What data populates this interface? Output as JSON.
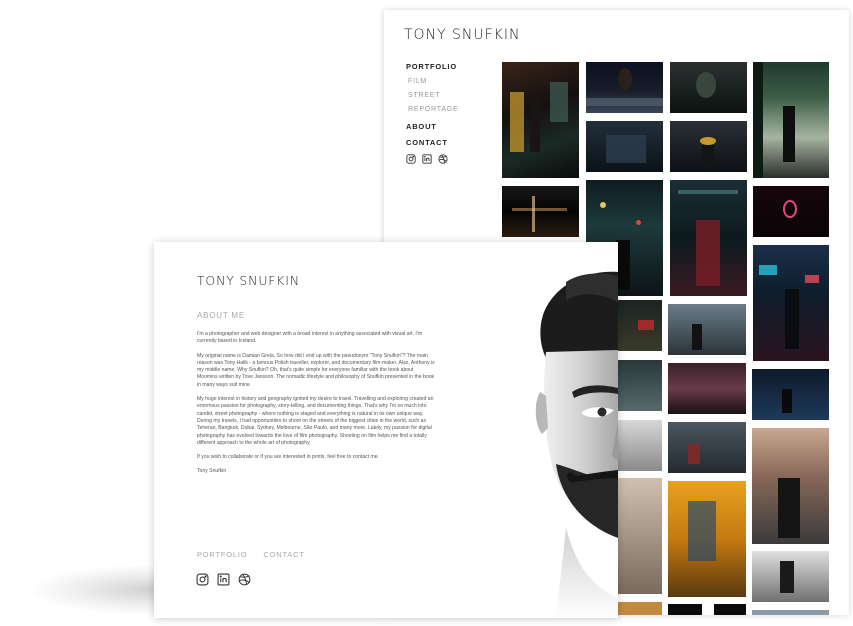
{
  "portfolio_window": {
    "brand": "TONY SNUFKIN",
    "nav": {
      "portfolio": "PORTFOLIO",
      "sub_items": [
        "FILM",
        "STREET",
        "REPORTAGE"
      ],
      "about": "ABOUT",
      "contact": "CONTACT"
    },
    "social_icons": [
      "instagram-icon",
      "linkedin-icon",
      "dribbble-icon"
    ]
  },
  "about_window": {
    "brand": "TONY SNUFKIN",
    "section_title": "ABOUT ME",
    "paragraphs": [
      "I'm a photographer and web designer with a broad interest in anything associated with visual art. I'm currently based in Iceland.",
      "My original name is Damian Grela. So how did I end up with the pseudonym \"Tony Snufkin\"? The main reason was Tony Halik - a famous Polish traveller, explorer, and documentary film-maker. Also, Anthony is my middle name. Why Snufkin? Oh, that's quite simple for everyone familiar with the book about Moomins written by Tove Jansson. The nomadic lifestyle and philosophy of Snufkin presented in the book in many ways suit mine.",
      "My huge interest in history and geography ignited my desire to travel. Travelling and exploring created an enormous passion for photography, story-telling, and documenting things. That's why I'm so much into candid, street photography - where nothing is staged and everything is natural in its own unique way. During my travels, I had opportunities to shoot on the streets of the biggest cities in the world, such as Teheran, Bangkok, Dubai, Sydney, Melbourne, São Paulo, and many more. Lately, my passion for digital photography has evolved towards the love of film photography. Shooting on film helps me find a totally different approach to the whole art of photography.",
      "If you wish to collaborate or if you are interested in prints, feel free to contact me.",
      "Tony Snufkin"
    ],
    "bottom_nav": {
      "portfolio": "PORTFOLIO",
      "contact": "CONTACT"
    },
    "social_icons": [
      "instagram-icon",
      "linkedin-icon",
      "dribbble-icon"
    ]
  },
  "colors": {
    "background": "#ffffff",
    "text_dark": "#222222",
    "text_muted": "#a8a8a8"
  }
}
